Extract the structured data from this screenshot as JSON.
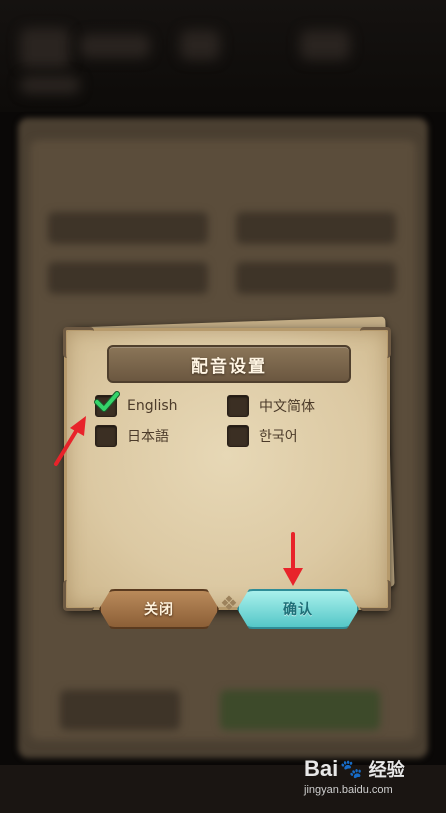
{
  "dialog": {
    "title": "配音设置",
    "options": [
      {
        "label": "English",
        "checked": true
      },
      {
        "label": "中文简体",
        "checked": false
      },
      {
        "label": "日本語",
        "checked": false
      },
      {
        "label": "한국어",
        "checked": false
      }
    ],
    "close_label": "关闭",
    "confirm_label": "确认"
  },
  "colors": {
    "check": "#35d46a",
    "arrow": "#e8232a",
    "confirm": "#6fd3d3"
  },
  "watermark": {
    "brand_left": "Bai",
    "brand_right": "经验",
    "url": "jingyan.baidu.com"
  }
}
